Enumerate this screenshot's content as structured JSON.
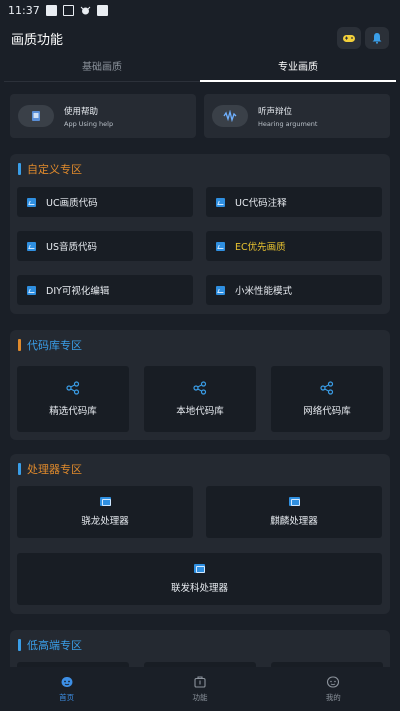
{
  "status_bar": {
    "time": "11:37"
  },
  "header": {
    "title": "画质功能"
  },
  "tabs": [
    {
      "label": "基础画质",
      "active": false
    },
    {
      "label": "专业画质",
      "active": true
    }
  ],
  "help_cards": [
    {
      "title": "使用帮助",
      "subtitle": "App Using help",
      "icon": "help-device-icon"
    },
    {
      "title": "听声辩位",
      "subtitle": "Hearing argument",
      "icon": "sound-wave-icon"
    }
  ],
  "custom_section": {
    "title": "自定义专区",
    "accent": "#e08a2c",
    "items": [
      {
        "label": "UC画质代码",
        "highlight": false
      },
      {
        "label": "UC代码注释",
        "highlight": false
      },
      {
        "label": "US音质代码",
        "highlight": false
      },
      {
        "label": "EC优先画质",
        "highlight": true
      },
      {
        "label": "DIY可视化编辑",
        "highlight": false
      },
      {
        "label": "小米性能模式",
        "highlight": false
      }
    ]
  },
  "library_section": {
    "title": "代码库专区",
    "accent": "#e08a2c",
    "items": [
      {
        "label": "精选代码库"
      },
      {
        "label": "本地代码库"
      },
      {
        "label": "网络代码库"
      }
    ]
  },
  "processor_section": {
    "title": "处理器专区",
    "accent": "#e08a2c",
    "items": [
      {
        "label": "骁龙处理器"
      },
      {
        "label": "麒麟处理器"
      },
      {
        "label": "联发科处理器"
      }
    ]
  },
  "lowhigh_section": {
    "title": "低高端专区",
    "accent": "#3a9ee8"
  },
  "bottom_nav": [
    {
      "label": "首页",
      "active": true,
      "icon": "home-face-icon"
    },
    {
      "label": "功能",
      "active": false,
      "icon": "toolbox-icon"
    },
    {
      "label": "我的",
      "active": false,
      "icon": "profile-face-icon"
    }
  ],
  "colors": {
    "background": "#1a1f27",
    "card": "#242931",
    "item": "#181d24",
    "accent_blue": "#2f8fe0",
    "highlight_yellow": "#e8c230"
  }
}
